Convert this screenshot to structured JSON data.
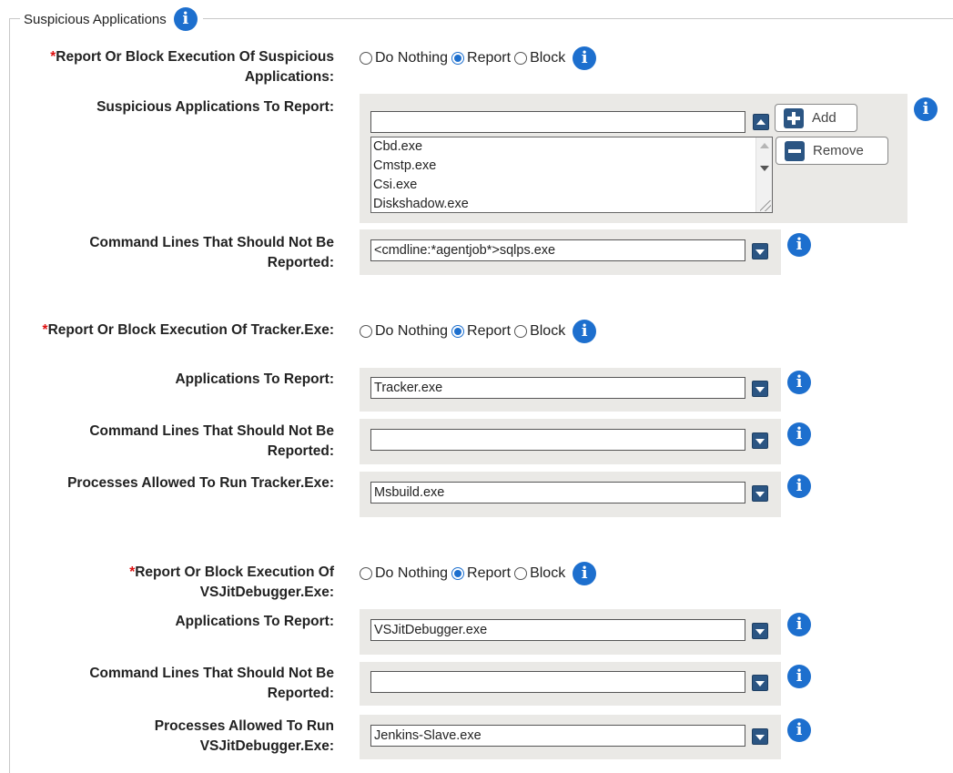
{
  "fieldset": {
    "legend": "Suspicious Applications"
  },
  "radio_options": {
    "nothing": "Do Nothing",
    "report": "Report",
    "block": "Block"
  },
  "required_mark": "*",
  "sections": {
    "suspicious": {
      "mode_label": "Report Or Block Execution Of Suspicious Applications:",
      "mode_selected": "Report",
      "apps_label": "Suspicious Applications To Report:",
      "apps_input_value": "",
      "apps_list": [
        "Cbd.exe",
        "Cmstp.exe",
        "Csi.exe",
        "Diskshadow.exe"
      ],
      "add_label": "Add",
      "remove_label": "Remove",
      "cmd_label": "Command Lines That Should Not Be Reported:",
      "cmd_value": "<cmdline:*agentjob*>sqlps.exe"
    },
    "tracker": {
      "mode_label": "Report Or Block Execution Of Tracker.Exe:",
      "mode_selected": "Report",
      "apps_label": "Applications To Report:",
      "apps_value": "Tracker.exe",
      "cmd_label": "Command Lines That Should Not Be Reported:",
      "cmd_value": "",
      "procs_label": "Processes Allowed To Run Tracker.Exe:",
      "procs_value": "Msbuild.exe"
    },
    "vsjit": {
      "mode_label": "Report Or Block Execution Of VSJitDebugger.Exe:",
      "mode_selected": "Report",
      "apps_label": "Applications To Report:",
      "apps_value": "VSJitDebugger.exe",
      "cmd_label": "Command Lines That Should Not Be Reported:",
      "cmd_value": "",
      "procs_label": "Processes Allowed To Run VSJitDebugger.Exe:",
      "procs_value": "Jenkins-Slave.exe"
    }
  },
  "colors": {
    "accent": "#1d6fce",
    "button_blue": "#2b5583",
    "panel_bg": "#eae9e6",
    "required": "#dd1111"
  }
}
